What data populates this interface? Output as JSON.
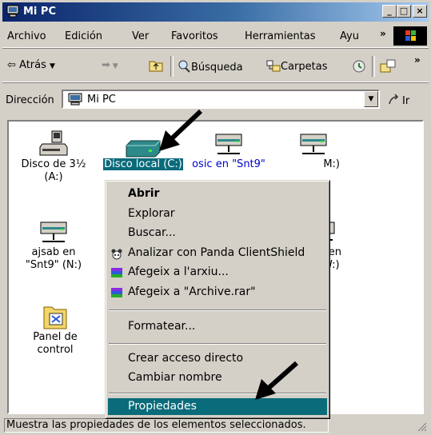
{
  "window": {
    "title": "Mi PC",
    "buttons": {
      "minimize": "_",
      "maximize": "□",
      "close": "×"
    }
  },
  "menubar": {
    "items": [
      "Archivo",
      "Edición",
      "Ver",
      "Favoritos",
      "Herramientas",
      "Ayu"
    ],
    "more": "»"
  },
  "toolbar": {
    "back": "Atrás",
    "search": "Búsqueda",
    "folders": "Carpetas",
    "more": "»"
  },
  "address": {
    "label": "Dirección",
    "value": "Mi PC",
    "go": "Ir"
  },
  "icons": [
    {
      "label_line1": "Disco de 3½",
      "label_line2": "(A:)"
    },
    {
      "label_line1": "Disco local (C:)"
    },
    {
      "label_line1": "osic en \"Snt9\""
    },
    {
      "label_line1": "M:)"
    },
    {
      "label_line1": "ajsab en",
      "label_line2": "\"Snt9\" (N:)"
    },
    {
      "label_line1": "l en",
      "label_line2": "W:)"
    },
    {
      "label_line1": "Panel de",
      "label_line2": "control"
    }
  ],
  "context_menu": {
    "items": [
      "Abrir",
      "Explorar",
      "Buscar...",
      "Analizar con Panda ClientShield",
      "Afegeix a l'arxiu...",
      "Afegeix a \"Archive.rar\"",
      "Formatear...",
      "Crear acceso directo",
      "Cambiar nombre",
      "Propiedades"
    ]
  },
  "status": {
    "text": "Muestra las propiedades de los elementos seleccionados."
  },
  "colors": {
    "title_start": "#0a246a",
    "selection": "#0a6b7a",
    "link": "#0000cc"
  }
}
